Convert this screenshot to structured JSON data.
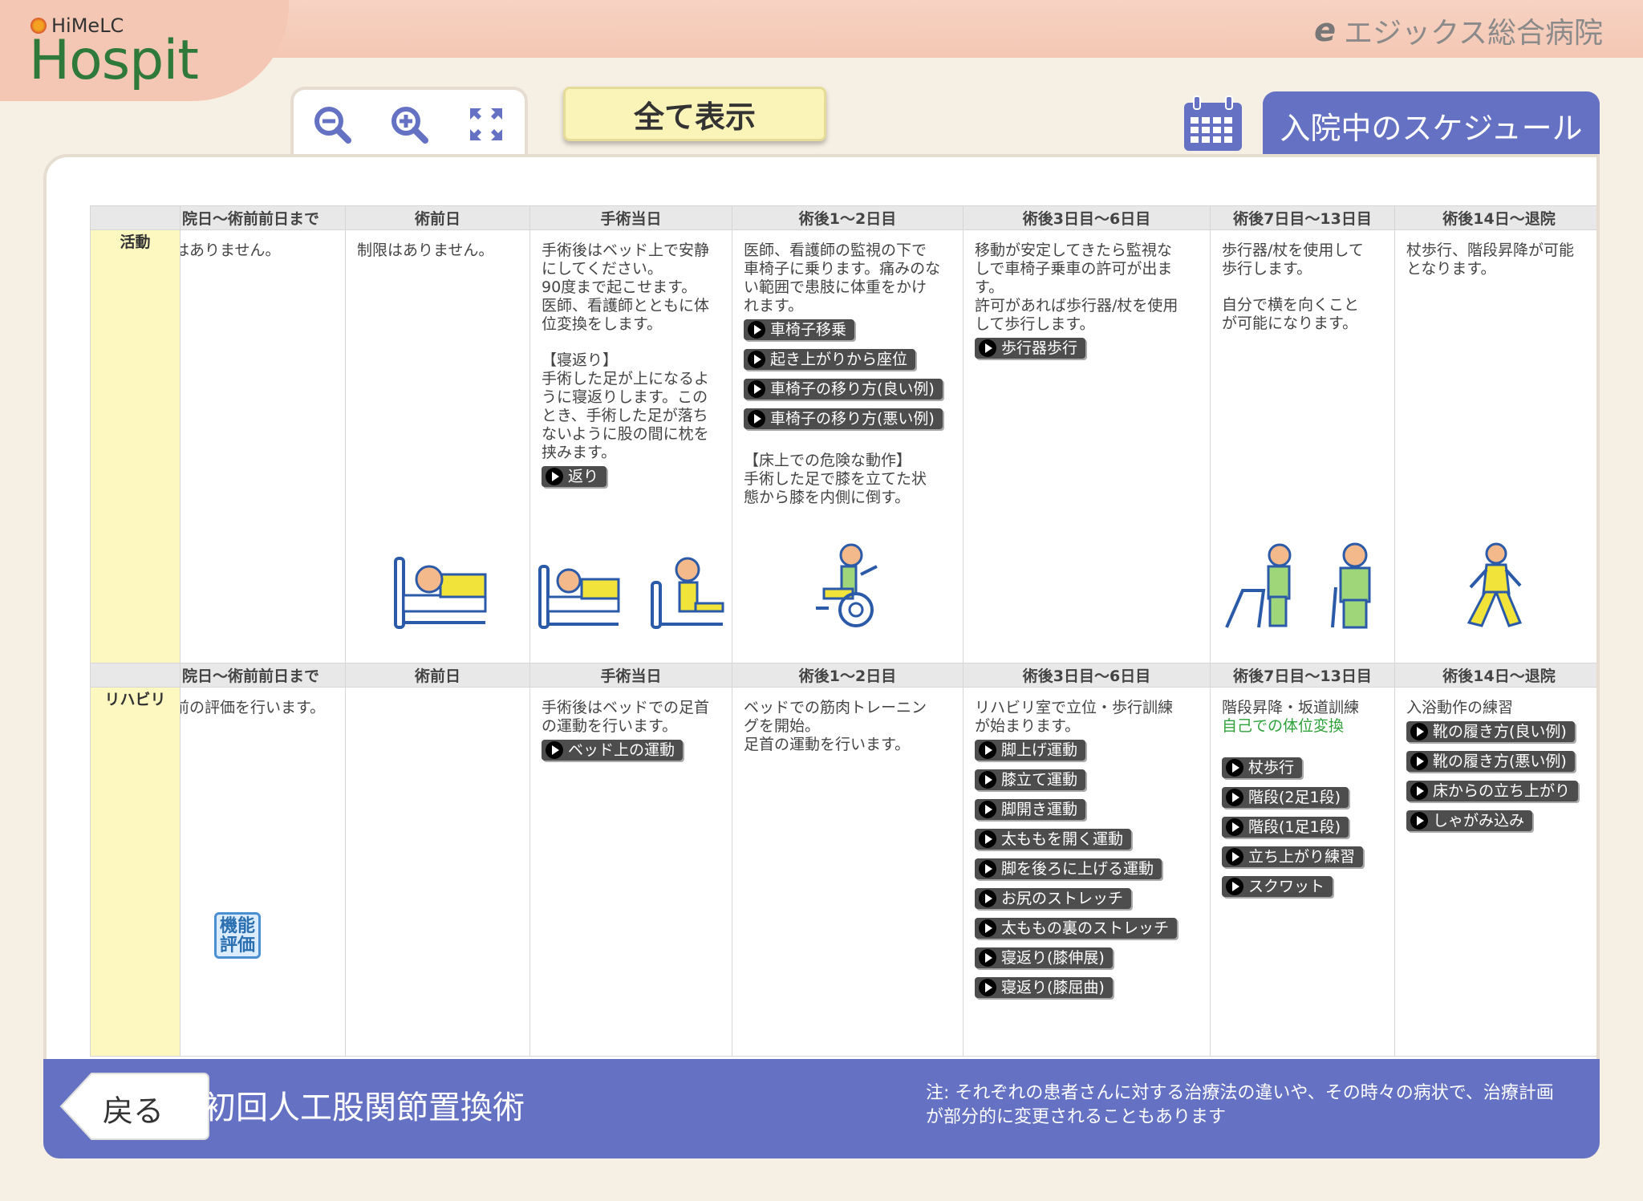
{
  "header": {
    "logo_small": "HiMeLC",
    "logo_big": "Hospit",
    "hospital_mark": "e",
    "hospital_name": "エジックス総合病院"
  },
  "toolbar": {
    "zoom_out_icon": "zoom-out-icon",
    "zoom_in_icon": "zoom-in-icon",
    "fullscreen_icon": "fullscreen-icon",
    "show_all_label": "全て表示",
    "calendar_icon": "calendar-icon",
    "schedule_tab_label": "入院中のスケジュール"
  },
  "colors": {
    "accent_blue": "#6571c3",
    "category_yellow": "#fcf8c0",
    "header_pink": "#f4c7b4",
    "logo_green": "#2f7a3a"
  },
  "schedule": {
    "columns": [
      "院日〜術前前日まで",
      "術前日",
      "手術当日",
      "術後1〜2日目",
      "術後3日目〜6日目",
      "術後7日目〜13日目",
      "術後14日〜退院"
    ],
    "activity": {
      "label": "活動",
      "cells": [
        {
          "text": [
            "はありません。"
          ]
        },
        {
          "text": [
            "制限はありません。"
          ]
        },
        {
          "text": [
            "手術後はベッド上で安静",
            "にしてください。",
            "90度まで起こせます。",
            "医師、看護師とともに体",
            "位変換をします。",
            "",
            "【寝返り】",
            "手術した足が上になるよ",
            "うに寝返りします。この",
            "とき、手術した足が落ち",
            "ないように股の間に枕を",
            "挟みます。"
          ],
          "buttons": [
            "返り"
          ]
        },
        {
          "text": [
            "医師、看護師の監視の下で",
            "車椅子に乗ります。痛みのな",
            "い範囲で患肢に体重をかけ",
            "れます。"
          ],
          "buttons": [
            "車椅子移乗",
            "起き上がりから座位",
            "車椅子の移り方(良い例)",
            "車椅子の移り方(悪い例)"
          ],
          "text2": [
            "【床上での危険な動作】",
            "手術した足で膝を立てた状",
            "態から膝を内側に倒す。"
          ]
        },
        {
          "text": [
            "移動が安定してきたら監視な",
            "しで車椅子乗車の許可が出ま",
            "す。",
            "許可があれば歩行器/杖を使用",
            "して歩行します。"
          ],
          "buttons": [
            "歩行器歩行"
          ]
        },
        {
          "text": [
            "歩行器/杖を使用して",
            "歩行します。",
            "",
            "自分で横を向くこと",
            "が可能になります。"
          ]
        },
        {
          "text": [
            "杖歩行、階段昇降が可能",
            "となります。"
          ]
        }
      ]
    },
    "rehab": {
      "label": "リハビリ",
      "stamp": "機能評価",
      "cells": [
        {
          "text": [
            "前の評価を行います。"
          ]
        },
        {
          "text": []
        },
        {
          "text": [
            "手術後はベッドでの足首",
            "の運動を行います。"
          ],
          "buttons": [
            "ベッド上の運動"
          ]
        },
        {
          "text": [
            "ベッドでの筋肉トレーニン",
            "グを開始。",
            "足首の運動を行います。"
          ]
        },
        {
          "text": [
            "リハビリ室で立位・歩行訓練",
            "が始まります。"
          ],
          "buttons": [
            "脚上げ運動",
            "膝立て運動",
            "脚開き運動",
            "太ももを開く運動",
            "脚を後ろに上げる運動",
            "お尻のストレッチ",
            "太ももの裏のストレッチ",
            "寝返り(膝伸展)",
            "寝返り(膝屈曲)"
          ]
        },
        {
          "text": [
            "階段昇降・坂道訓練"
          ],
          "green": "自己での体位変換",
          "buttons": [
            "杖歩行",
            "階段(2足1段)",
            "階段(1足1段)",
            "立ち上がり練習",
            "スクワット"
          ]
        },
        {
          "text": [
            "入浴動作の練習"
          ],
          "buttons": [
            "靴の履き方(良い例)",
            "靴の履き方(悪い例)",
            "床からの立ち上がり",
            "しゃがみ込み"
          ]
        }
      ]
    }
  },
  "footer": {
    "back_label": "戻る",
    "procedure": "初回人工股関節置換術",
    "note": "注: それぞれの患者さんに対する治療法の違いや、その時々の病状で、治療計画が部分的に変更されることもあります"
  }
}
